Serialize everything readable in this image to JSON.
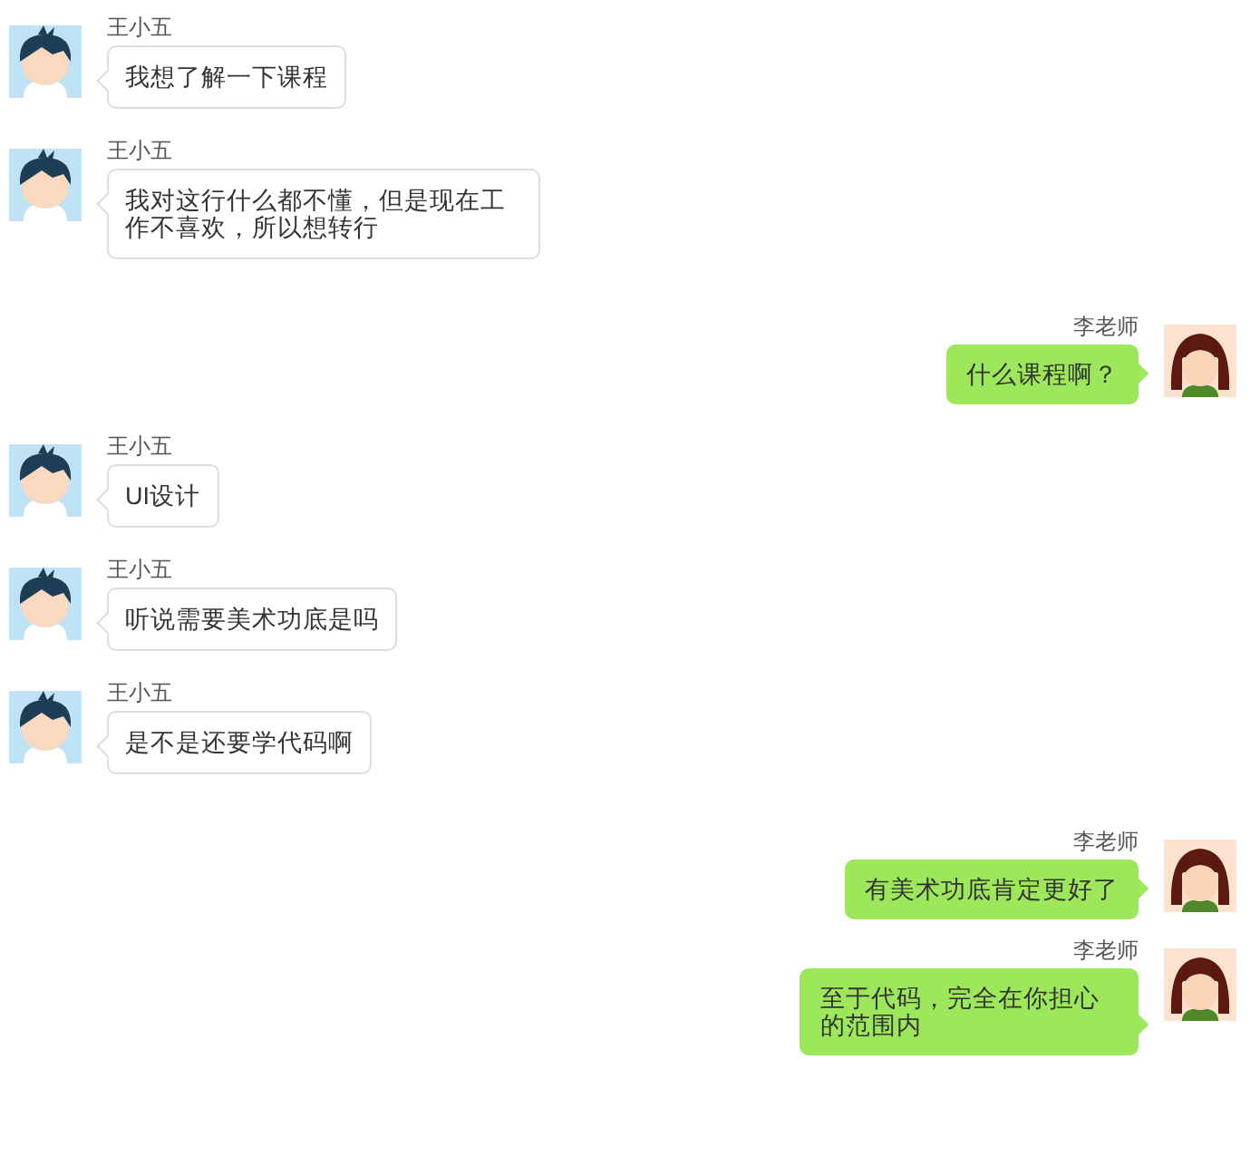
{
  "messages": [
    {
      "kind": "received",
      "sender": "王小五",
      "text": "我想了解一下课程"
    },
    {
      "kind": "received",
      "sender": "王小五",
      "text": "我对这行什么都不懂，但是现在工作不喜欢，所以想转行"
    },
    {
      "kind": "sent",
      "sender": "李老师",
      "text": "什么课程啊？"
    },
    {
      "kind": "received",
      "sender": "王小五",
      "text": "UI设计"
    },
    {
      "kind": "received",
      "sender": "王小五",
      "text": "听说需要美术功底是吗"
    },
    {
      "kind": "received",
      "sender": "王小五",
      "text": "是不是还要学代码啊"
    },
    {
      "kind": "sent",
      "sender": "李老师",
      "text": "有美术功底肯定更好了"
    },
    {
      "kind": "sent",
      "sender": "李老师",
      "text": "至于代码，完全在你担心的范围内"
    }
  ]
}
